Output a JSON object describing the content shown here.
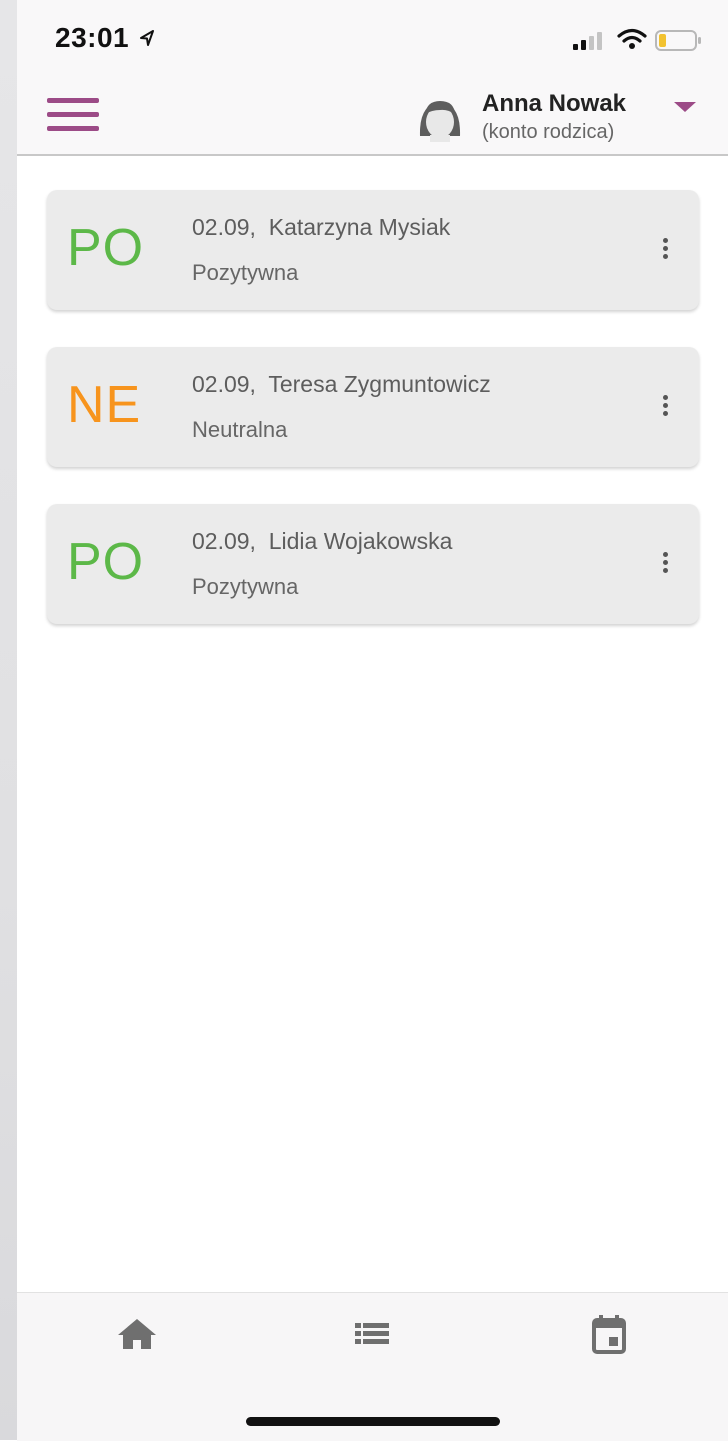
{
  "status_bar": {
    "time": "23:01",
    "icons": [
      "location-arrow-icon",
      "signal-icon",
      "wifi-icon",
      "battery-icon"
    ]
  },
  "header": {
    "menu_icon": "hamburger-icon",
    "user": {
      "name": "Anna Nowak",
      "role": "(konto rodzica)",
      "avatar_icon": "user-avatar-icon",
      "dropdown_icon": "caret-down-icon"
    }
  },
  "cards": [
    {
      "badge": "PO",
      "badge_color": "#5cb848",
      "date": "02.09,",
      "name": "Katarzyna Mysiak",
      "status": "Pozytywna"
    },
    {
      "badge": "NE",
      "badge_color": "#f7941d",
      "date": "02.09,",
      "name": "Teresa Zygmuntowicz",
      "status": "Neutralna"
    },
    {
      "badge": "PO",
      "badge_color": "#5cb848",
      "date": "02.09,",
      "name": "Lidia Wojakowska",
      "status": "Pozytywna"
    }
  ],
  "bottom_nav": [
    "home-icon",
    "list-icon",
    "calendar-icon"
  ],
  "colors": {
    "accent": "#9c4b87",
    "positive": "#5cb848",
    "neutral": "#f7941d"
  }
}
